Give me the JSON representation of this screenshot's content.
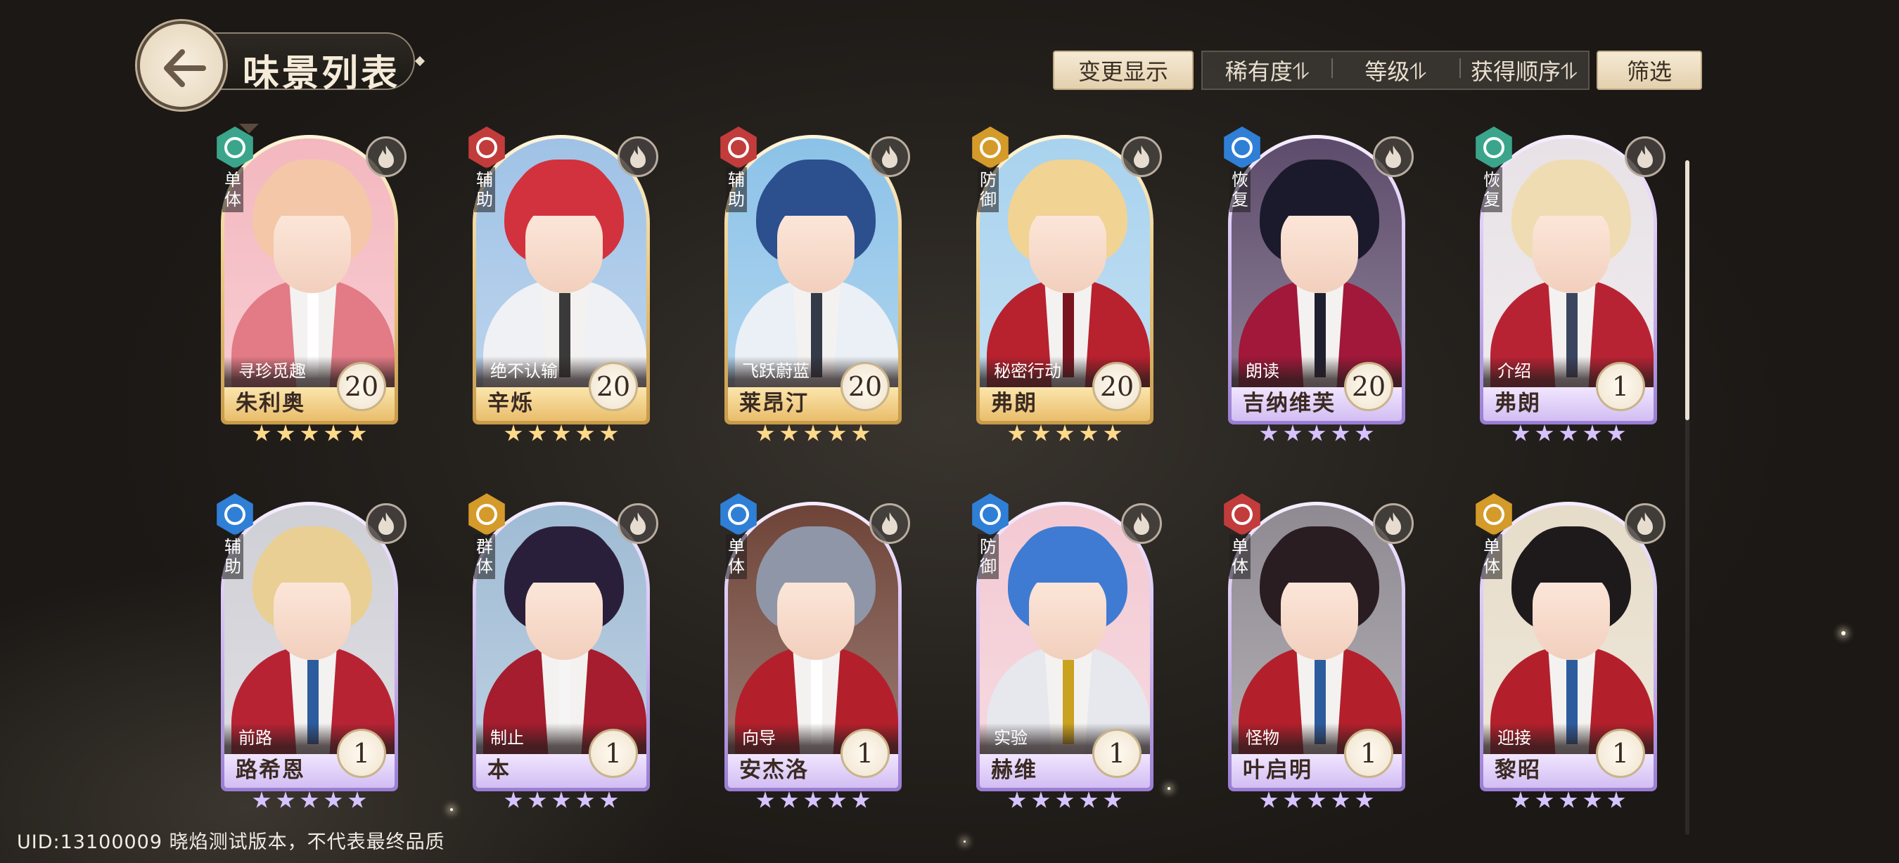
{
  "header": {
    "title": "味景列表",
    "back_label": "返回"
  },
  "toolbar": {
    "change_display": "变更显示",
    "sort": [
      "稀有度⥮",
      "等级⥮",
      "获得顺序⥮"
    ],
    "filter": "筛选"
  },
  "cards": [
    {
      "name": "朱利奥",
      "subtitle": "寻珍觅趣",
      "level": "20",
      "role": "单体",
      "rarity": "gold",
      "role_color": "#3aa58b",
      "hair": "#f3c7a8",
      "coat": "#e27b85",
      "tie": "#ffffff",
      "bg": "#f4b7bf",
      "icon": "hunt-icon"
    },
    {
      "name": "辛烁",
      "subtitle": "绝不认输",
      "level": "20",
      "role": "辅助",
      "rarity": "gold",
      "role_color": "#c23c3c",
      "hair": "#d2323d",
      "coat": "#f0f1f4",
      "tie": "#3a3a3a",
      "bg": "#9fc2e6",
      "icon": "support-icon"
    },
    {
      "name": "莱昂汀",
      "subtitle": "飞跃蔚蓝",
      "level": "20",
      "role": "辅助",
      "rarity": "gold",
      "role_color": "#c23c3c",
      "hair": "#2c4f8e",
      "coat": "#eaf0f6",
      "tie": "#333a48",
      "bg": "#8cc2e8",
      "icon": "support-icon"
    },
    {
      "name": "弗朗",
      "subtitle": "秘密行动",
      "level": "20",
      "role": "防御",
      "rarity": "gold",
      "role_color": "#d49a2a",
      "hair": "#f1d393",
      "coat": "#b8212e",
      "tie": "#7a1520",
      "bg": "#a8d2ee",
      "icon": "defense-icon"
    },
    {
      "name": "吉纳维芙",
      "subtitle": "朗读",
      "level": "20",
      "role": "恢复",
      "rarity": "purple",
      "role_color": "#2f7fd6",
      "hair": "#1b1a2c",
      "coat": "#a1183a",
      "tie": "#1e2030",
      "bg": "#5d4b6b",
      "icon": "heal-icon"
    },
    {
      "name": "弗朗",
      "subtitle": "介绍",
      "level": "1",
      "role": "恢复",
      "rarity": "purple",
      "role_color": "#3aa58b",
      "hair": "#f0dcb3",
      "coat": "#b82334",
      "tie": "#3a4660",
      "bg": "#e8e2e6",
      "icon": "heal-icon"
    },
    {
      "name": "路希恩",
      "subtitle": "前路",
      "level": "1",
      "role": "辅助",
      "rarity": "purple",
      "role_color": "#2f7fd6",
      "hair": "#e9cf93",
      "coat": "#b82334",
      "tie": "#2d5c9e",
      "bg": "#cfcfd6",
      "icon": "support-icon"
    },
    {
      "name": "本",
      "subtitle": "制止",
      "level": "1",
      "role": "群体",
      "rarity": "purple",
      "role_color": "#d49a2a",
      "hair": "#2a1f3a",
      "coat": "#a51d2e",
      "tie": "#f5f5f5",
      "bg": "#9fbbd4",
      "icon": "group-icon"
    },
    {
      "name": "安杰洛",
      "subtitle": "向导",
      "level": "1",
      "role": "单体",
      "rarity": "purple",
      "role_color": "#2f7fd6",
      "hair": "#8f96a7",
      "coat": "#b3202c",
      "tie": "#ffffff",
      "bg": "#6f4438",
      "icon": "hunt-icon"
    },
    {
      "name": "赫维",
      "subtitle": "实验",
      "level": "1",
      "role": "防御",
      "rarity": "purple",
      "role_color": "#2f7fd6",
      "hair": "#3f7bd2",
      "coat": "#e6e8ee",
      "tie": "#c9a220",
      "bg": "#f3c9d2",
      "icon": "defense-icon"
    },
    {
      "name": "叶启明",
      "subtitle": "怪物",
      "level": "1",
      "role": "单体",
      "rarity": "purple",
      "role_color": "#c23c3c",
      "hair": "#2a1d22",
      "coat": "#b3202c",
      "tie": "#2d5c9e",
      "bg": "#8f8a92",
      "icon": "hunt-icon"
    },
    {
      "name": "黎昭",
      "subtitle": "迎接",
      "level": "1",
      "role": "单体",
      "rarity": "purple",
      "role_color": "#d49a2a",
      "hair": "#1e1a1c",
      "coat": "#b3202c",
      "tie": "#2d5c9e",
      "bg": "#e6dcc9",
      "icon": "hunt-icon"
    }
  ],
  "footer": {
    "text": "UID:13100009   晓焰测试版本，不代表最终品质"
  }
}
